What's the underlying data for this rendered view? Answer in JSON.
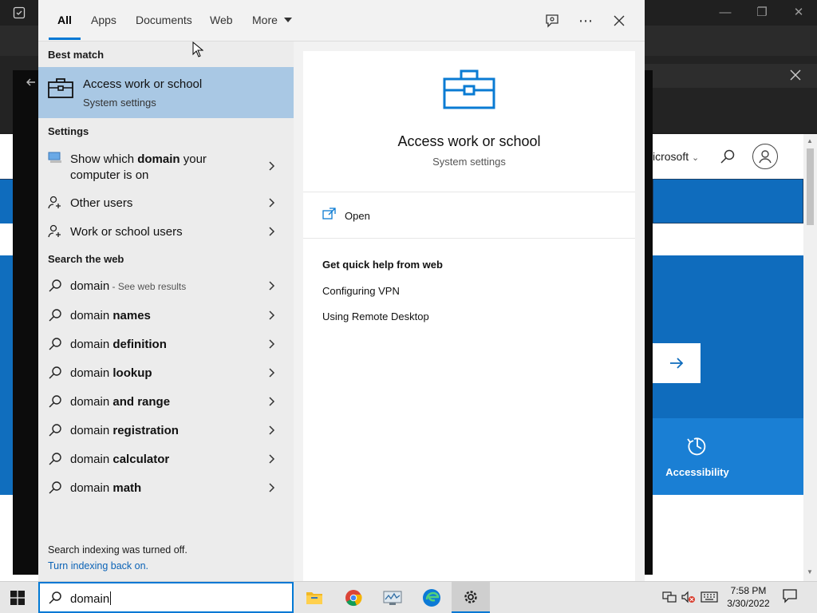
{
  "search": {
    "tabs": [
      "All",
      "Apps",
      "Documents",
      "Web",
      "More"
    ],
    "query": "domain"
  },
  "best_match": {
    "section": "Best match",
    "title": "Access work or school",
    "subtitle": "System settings"
  },
  "settings": {
    "section": "Settings",
    "items": [
      {
        "pre": "Show which ",
        "bold": "domain",
        "post": " your",
        "line2": "computer is on"
      },
      {
        "label": "Other users"
      },
      {
        "label": "Work or school users"
      }
    ]
  },
  "web": {
    "section": "Search the web",
    "first": {
      "term": "domain",
      "hint": " - See web results"
    },
    "items": [
      {
        "pre": "domain ",
        "bold": "names"
      },
      {
        "pre": "domain ",
        "bold": "definition"
      },
      {
        "pre": "domain ",
        "bold": "lookup"
      },
      {
        "pre": "domain ",
        "bold": "and range"
      },
      {
        "pre": "domain ",
        "bold": "registration"
      },
      {
        "pre": "domain ",
        "bold": "calculator"
      },
      {
        "pre": "domain ",
        "bold": "math"
      }
    ]
  },
  "indexing": {
    "notice": "Search indexing was turned off.",
    "link": "Turn indexing back on."
  },
  "preview": {
    "title": "Access work or school",
    "subtitle": "System settings",
    "open_label": "Open",
    "help_heading": "Get quick help from web",
    "links": [
      "Configuring VPN",
      "Using Remote Desktop"
    ]
  },
  "background_page": {
    "brand_fragment": "icrosoft",
    "accessibility_label": "Accessibility"
  },
  "taskbar": {
    "time": "7:58 PM",
    "date": "3/30/2022"
  },
  "colors": {
    "accent": "#0078d4",
    "best_match_highlight": "#a9c8e4",
    "link": "#0b63b6"
  }
}
